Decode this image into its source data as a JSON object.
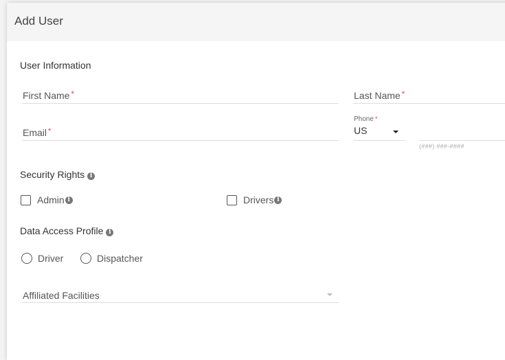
{
  "dialog": {
    "title": "Add User"
  },
  "user_information": {
    "title": "User Information",
    "first_name": {
      "label": "First Name",
      "required_mark": "*"
    },
    "last_name": {
      "label": "Last Name",
      "required_mark": "*"
    },
    "email": {
      "label": "Email",
      "required_mark": "*"
    },
    "phone": {
      "label": "Phone",
      "required_mark": "*",
      "country_value": "US",
      "number_hint": "(###) ###-####"
    }
  },
  "security_rights": {
    "title": "Security Rights",
    "info_glyph": "i",
    "options": [
      {
        "label": "Admin",
        "checked": false
      },
      {
        "label": "Drivers",
        "checked": false
      }
    ]
  },
  "data_access_profile": {
    "title": "Data Access Profile",
    "options": [
      {
        "label": "Driver",
        "selected": false
      },
      {
        "label": "Dispatcher",
        "selected": false
      }
    ]
  },
  "affiliated_facilities": {
    "label": "Affiliated Facilities"
  },
  "colors": {
    "required": "#e53935",
    "header_bg": "#f5f5f5",
    "underline": "#dcdcdc"
  },
  "icons": {
    "info": "info-icon",
    "dropdown": "chevron-down-icon"
  }
}
